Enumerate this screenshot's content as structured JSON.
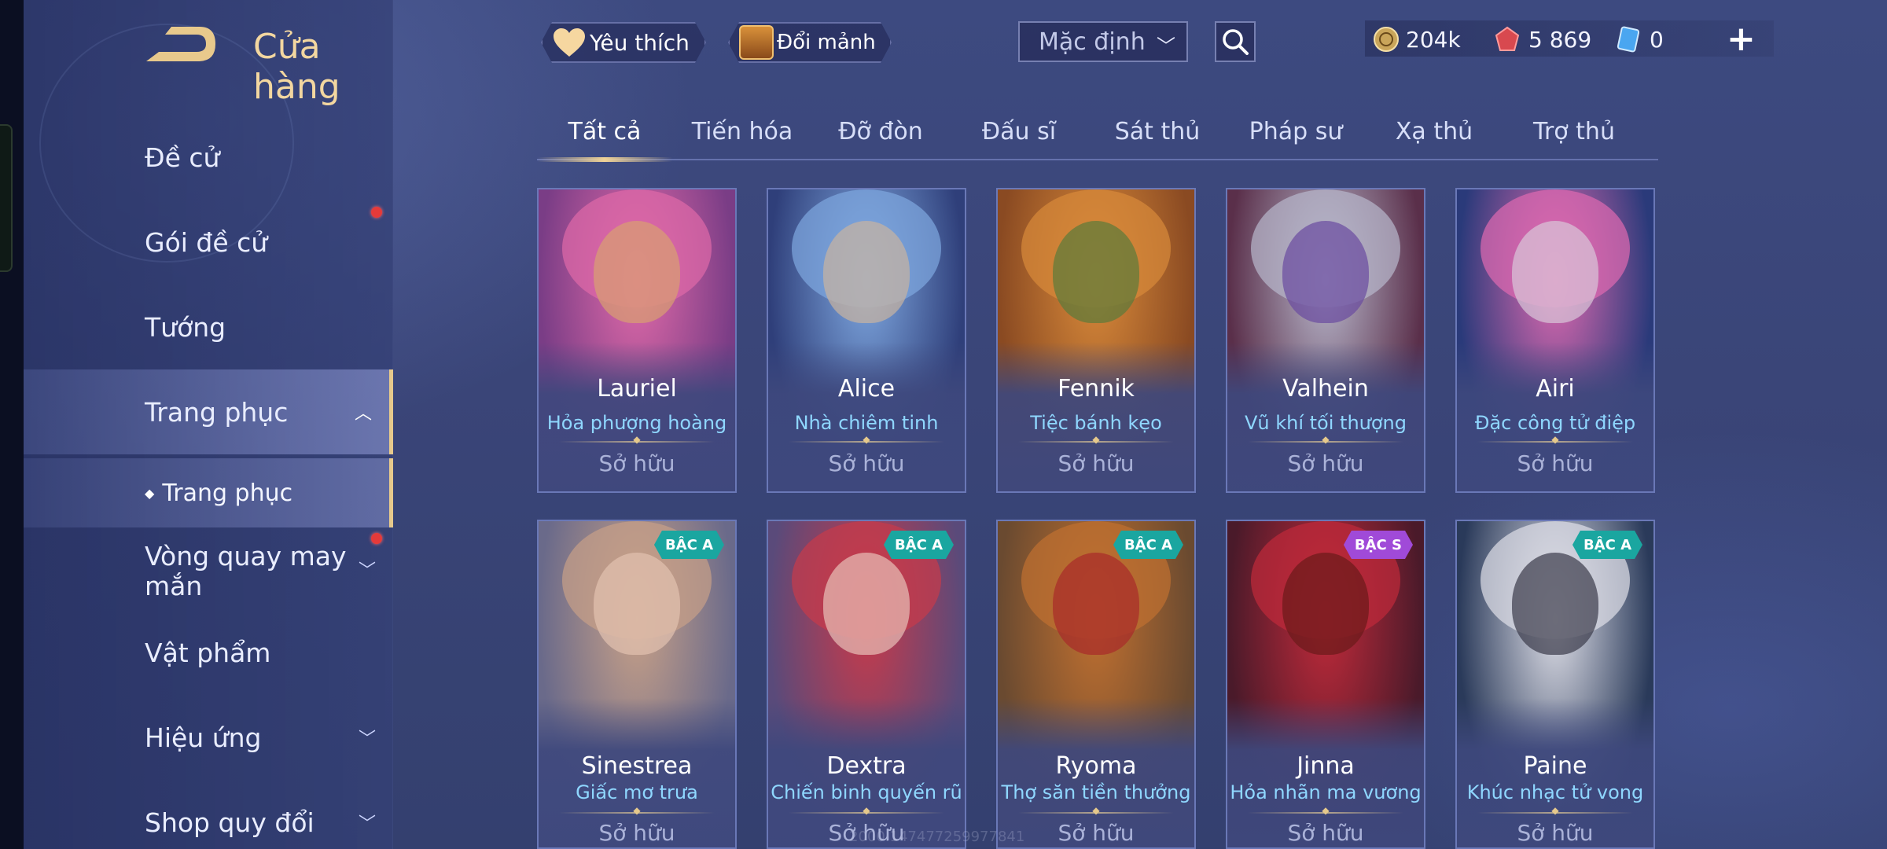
{
  "header": {
    "title": "Cửa hàng",
    "favorite_label": "Yêu thích",
    "exchange_label": "Đổi mảnh",
    "sort_selected": "Mặc định",
    "currencies": [
      {
        "icon": "gold-coin-icon",
        "value": "204k"
      },
      {
        "icon": "red-gem-icon",
        "value": "5 869"
      },
      {
        "icon": "blue-voucher-icon",
        "value": "0"
      }
    ]
  },
  "sidebar": {
    "items": [
      {
        "label": "Đề cử"
      },
      {
        "label": "Gói đề cử"
      },
      {
        "label": "Tướng"
      },
      {
        "label": "Trang phục"
      },
      {
        "label": "Vòng quay may mắn"
      },
      {
        "label": "Vật phẩm"
      },
      {
        "label": "Hiệu ứng"
      },
      {
        "label": "Shop quy đổi"
      }
    ],
    "sub_items": [
      {
        "label": "Trang phục"
      }
    ]
  },
  "tabs": [
    "Tất cả",
    "Tiến hóa",
    "Đỡ đòn",
    "Đấu sĩ",
    "Sát thủ",
    "Pháp sư",
    "Xạ thủ",
    "Trợ thủ"
  ],
  "cards": [
    {
      "hero": "Lauriel",
      "skin": "Hỏa phượng hoàng",
      "status": "Sở hữu",
      "badge": "",
      "colors": [
        "#7a3d86",
        "#e06aa8",
        "#d9a070"
      ]
    },
    {
      "hero": "Alice",
      "skin": "Nhà chiêm tinh",
      "status": "Sở hữu",
      "badge": "",
      "colors": [
        "#2f3f7a",
        "#7fa8e0",
        "#c9b3a0"
      ]
    },
    {
      "hero": "Fennik",
      "skin": "Tiệc bánh kẹo",
      "status": "Sở hữu",
      "badge": "",
      "colors": [
        "#8a4a22",
        "#d98a3a",
        "#5a7a3a"
      ]
    },
    {
      "hero": "Valhein",
      "skin": "Vũ khí tối thượng",
      "status": "Sở hữu",
      "badge": "",
      "colors": [
        "#5a2f4a",
        "#b8b8cc",
        "#6a4aa0"
      ]
    },
    {
      "hero": "Airi",
      "skin": "Đặc công tử điệp",
      "status": "Sở hữu",
      "badge": "",
      "colors": [
        "#2a3a7a",
        "#e06ab0",
        "#d8c8d8"
      ]
    },
    {
      "hero": "Sinestrea",
      "skin": "Giấc mơ trưa",
      "status": "Sở hữu",
      "badge": "BẬC A",
      "colors": [
        "#6a6a8a",
        "#c7a088",
        "#e2c2b0"
      ]
    },
    {
      "hero": "Dextra",
      "skin": "Chiến binh quyến rũ",
      "status": "Sở hữu",
      "badge": "BẬC A",
      "colors": [
        "#5a4a7a",
        "#c83a4a",
        "#e8c0b8"
      ]
    },
    {
      "hero": "Ryoma",
      "skin": "Thợ săn tiền thưởng",
      "status": "Sở hữu",
      "badge": "BẬC A",
      "colors": [
        "#6a4a30",
        "#c07030",
        "#a82a2a"
      ]
    },
    {
      "hero": "Jinna",
      "skin": "Hỏa nhãn ma vương",
      "status": "Sở hữu",
      "badge": "BẬC S",
      "colors": [
        "#4a1a2a",
        "#c02a3a",
        "#6a1a1a"
      ]
    },
    {
      "hero": "Paine",
      "skin": "Khúc nhạc tử vong",
      "status": "Sở hữu",
      "badge": "BẬC A",
      "colors": [
        "#2a3a5a",
        "#e0e0e8",
        "#3a3a4a"
      ]
    }
  ],
  "watermark": "2000.147477259977841"
}
